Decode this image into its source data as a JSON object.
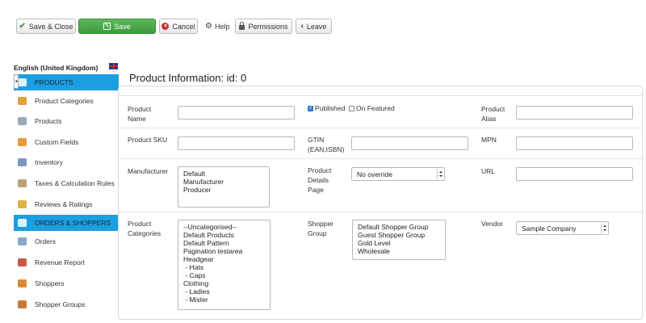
{
  "toolbar": {
    "save_close": "Save & Close",
    "save": "Save",
    "cancel": "Cancel",
    "help": "Help",
    "permissions": "Permissions",
    "leave": "Leave"
  },
  "sidebar": {
    "language": "English (United Kingdom)",
    "items": [
      {
        "label": "PRODUCTS",
        "active": true
      },
      {
        "label": "Product Categories"
      },
      {
        "label": "Products"
      },
      {
        "label": "Custom Fields"
      },
      {
        "label": "Inventory"
      },
      {
        "label": "Taxes & Calculation Rules"
      },
      {
        "label": "Reviews & Ratings"
      },
      {
        "label": "ORDERS & SHOPPERS",
        "active": true
      },
      {
        "label": "Orders"
      },
      {
        "label": "Revenue Report"
      },
      {
        "label": "Shoppers"
      },
      {
        "label": "Shopper Groups"
      }
    ]
  },
  "main": {
    "title": "Product Information: id: 0",
    "labels": {
      "product_name": "Product Name",
      "published": "Published",
      "on_featured": "On Featured",
      "product_alias": "Product Alias",
      "product_sku": "Product SKU",
      "gtin": "GTIN (EAN,ISBN)",
      "mpn": "MPN",
      "manufacturer": "Manufacturer",
      "product_details_page": "Product Details Page",
      "url": "URL",
      "product_categories": "Product Categories",
      "shopper_group": "Shopper Group",
      "vendor": "Vendor"
    },
    "published_checked": true,
    "on_featured_checked": false,
    "manufacturer_options": [
      "Default",
      "Manufacturer",
      "Producer"
    ],
    "details_page_value": "No override",
    "category_options": [
      "--Uncategorised--",
      "Default Products",
      "Default Pattern",
      "Pagination testarea",
      "Headgear",
      " - Hats",
      " - Caps",
      "Clothing",
      " - Ladies",
      " - Mister"
    ],
    "shopper_group_options": [
      "Default Shopper Group",
      "Guest Shopper Group",
      "Gold Level",
      "Wholesale"
    ],
    "vendor_value": "Sample Company"
  },
  "colors": {
    "save_green": "#4cae4c",
    "sidebar_active": "#1d9ee0"
  }
}
